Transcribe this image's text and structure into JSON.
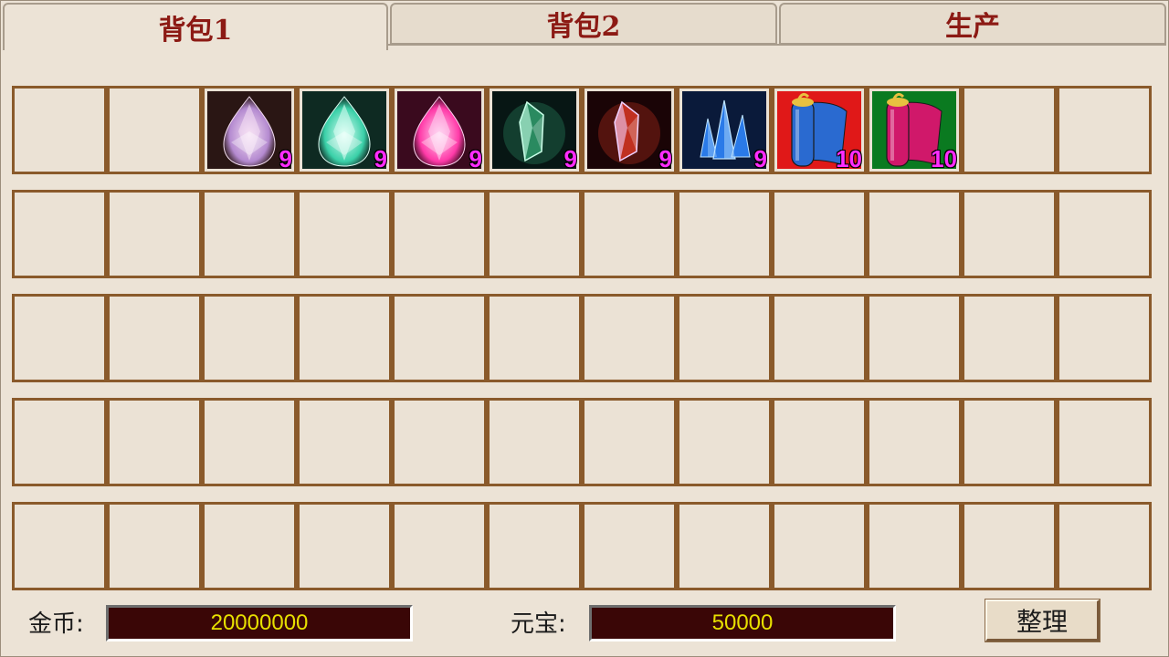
{
  "tabs": [
    {
      "label": "背包1",
      "active": true
    },
    {
      "label": "背包2",
      "active": false
    },
    {
      "label": "生产",
      "active": false
    }
  ],
  "grid": {
    "rows": 5,
    "cols": 12,
    "items": [
      {
        "slot": 2,
        "icon": "white-pear-gem-icon",
        "count": "9",
        "colors": [
          "#2a1614",
          "#f6e0f4",
          "#b48ad0"
        ]
      },
      {
        "slot": 3,
        "icon": "cyan-pear-gem-icon",
        "count": "9",
        "colors": [
          "#0e2a22",
          "#e0fff6",
          "#3ad0a8"
        ]
      },
      {
        "slot": 4,
        "icon": "pink-pear-gem-icon",
        "count": "9",
        "colors": [
          "#3a0a1e",
          "#ffd6f2",
          "#ff3aa8"
        ]
      },
      {
        "slot": 5,
        "icon": "green-crystal-icon",
        "count": "9",
        "colors": [
          "#071614",
          "#c8ffe8",
          "#2a8a60"
        ]
      },
      {
        "slot": 6,
        "icon": "purple-crystal-icon",
        "count": "9",
        "colors": [
          "#1a0406",
          "#f0d0ff",
          "#c03020"
        ]
      },
      {
        "slot": 7,
        "icon": "blue-crystal-cluster-icon",
        "count": "9",
        "colors": [
          "#0a1a3a",
          "#bfe4ff",
          "#2a7ae8"
        ]
      },
      {
        "slot": 8,
        "icon": "blue-scroll-icon",
        "count": "10",
        "colors": [
          "#e01818",
          "#2a6ad0",
          "#e8c040"
        ]
      },
      {
        "slot": 9,
        "icon": "red-scroll-icon",
        "count": "10",
        "colors": [
          "#0a7a20",
          "#d0186a",
          "#e8c040"
        ]
      }
    ]
  },
  "footer": {
    "gold_label": "金币:",
    "gold_value": "20000000",
    "yuanbao_label": "元宝:",
    "yuanbao_value": "50000",
    "sort_label": "整理"
  }
}
